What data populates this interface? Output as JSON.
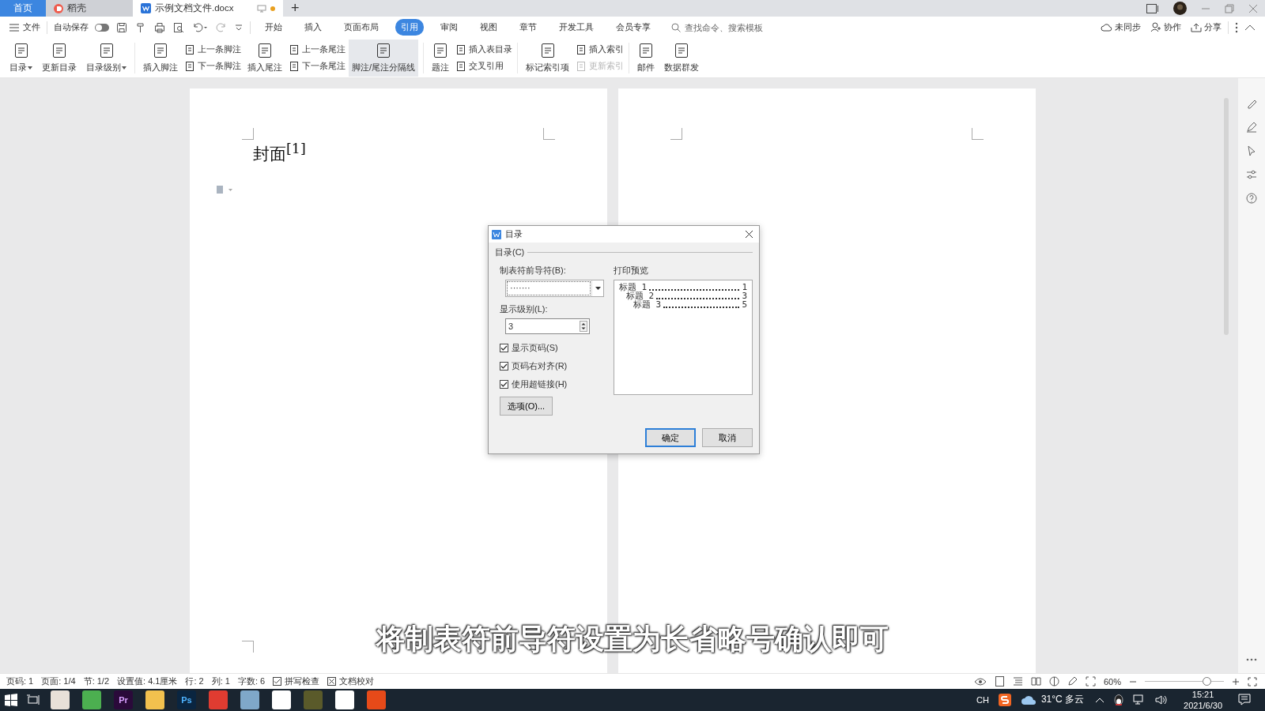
{
  "tabs": [
    {
      "kind": "home",
      "label": "首页",
      "selected": false
    },
    {
      "kind": "app",
      "label": "稻壳",
      "selected": false
    },
    {
      "kind": "doc",
      "label": "示例文档文件.docx",
      "selected": true,
      "unsaved": true
    }
  ],
  "new_tab": "+",
  "menu": {
    "file": "文件",
    "autosave": {
      "label": "自动保存",
      "on": false
    },
    "tabs": [
      {
        "label": "开始",
        "selected": false
      },
      {
        "label": "插入",
        "selected": false
      },
      {
        "label": "页面布局",
        "selected": false
      },
      {
        "label": "引用",
        "selected": true
      },
      {
        "label": "审阅",
        "selected": false
      },
      {
        "label": "视图",
        "selected": false
      },
      {
        "label": "章节",
        "selected": false
      },
      {
        "label": "开发工具",
        "selected": false
      },
      {
        "label": "会员专享",
        "selected": false
      }
    ],
    "search": {
      "placeholder": "查找命令、搜索模板"
    },
    "actions": [
      {
        "kind": "sync",
        "label": "未同步"
      },
      {
        "kind": "collab",
        "label": "协作"
      },
      {
        "kind": "share",
        "label": "分享"
      }
    ]
  },
  "ribbon": [
    {
      "items": [
        {
          "kind": "large",
          "label": "目录",
          "has_menu": true,
          "on": false
        },
        {
          "kind": "large",
          "label": "更新目录",
          "has_menu": false,
          "on": false
        },
        {
          "kind": "large",
          "label": "目录级别",
          "has_menu": true,
          "on": false
        }
      ]
    },
    {
      "items": [
        {
          "kind": "large",
          "label": "插入脚注",
          "has_menu": false,
          "on": false
        },
        {
          "kind": "stack",
          "items": [
            {
              "label": "上一条脚注",
              "disabled": false
            },
            {
              "label": "下一条脚注",
              "disabled": false
            }
          ]
        },
        {
          "kind": "large",
          "label": "插入尾注",
          "has_menu": false,
          "on": false
        },
        {
          "kind": "stack",
          "items": [
            {
              "label": "上一条尾注",
              "disabled": false
            },
            {
              "label": "下一条尾注",
              "disabled": false
            }
          ]
        },
        {
          "kind": "large",
          "label": "脚注/尾注分隔线",
          "has_menu": false,
          "on": true
        }
      ]
    },
    {
      "items": [
        {
          "kind": "large",
          "label": "题注",
          "has_menu": false,
          "on": false
        },
        {
          "kind": "stack",
          "items": [
            {
              "label": "插入表目录",
              "disabled": false
            },
            {
              "label": "交叉引用",
              "disabled": false
            }
          ]
        }
      ]
    },
    {
      "items": [
        {
          "kind": "large",
          "label": "标记索引项",
          "has_menu": false,
          "on": false
        },
        {
          "kind": "stack",
          "items": [
            {
              "label": "插入索引",
              "disabled": false
            },
            {
              "label": "更新索引",
              "disabled": true
            }
          ]
        }
      ]
    },
    {
      "items": [
        {
          "kind": "large",
          "label": "邮件",
          "has_menu": false,
          "on": false
        },
        {
          "kind": "large",
          "label": "数据群发",
          "has_menu": false,
          "on": false
        }
      ]
    }
  ],
  "document": {
    "heading": "封面$^{[1]}$"
  },
  "dialog": {
    "title": "目录",
    "section": "目录(C)",
    "leader_label": "制表符前导符(B):",
    "leader_value": "·······",
    "level_label": "显示级别(L):",
    "level_value": "3",
    "checkboxes": [
      {
        "label": "显示页码(S)",
        "checked": true
      },
      {
        "label": "页码右对齐(R)",
        "checked": true
      },
      {
        "label": "使用超链接(H)",
        "checked": true
      }
    ],
    "options_button": "选项(O)...",
    "preview_label": "打印预览",
    "preview": [
      {
        "text": "标题 1",
        "page": "1",
        "children": [
          {
            "text": "标题 2",
            "page": "3",
            "children": [
              {
                "text": "标题 3",
                "page": "5"
              }
            ]
          }
        ]
      }
    ],
    "ok": "确定",
    "cancel": "取消"
  },
  "subtitle": "将制表符前导符设置为长省略号确认即可",
  "status_bar": {
    "items": [
      "页码: 1",
      "页面: 1/4",
      "节: 1/2",
      "设置值: 4.1厘米",
      "行: 2",
      "列: 1",
      "字数: 6"
    ],
    "checks": [
      "拼写检查",
      "文档校对"
    ],
    "zoom": "60%",
    "zoom_slider": {
      "level": 0.8
    }
  },
  "taskbar": {
    "apps": [
      {
        "kind": "office"
      },
      {
        "kind": "chrome"
      },
      {
        "kind": "premiere",
        "glyph": "Pr"
      },
      {
        "kind": "folder"
      },
      {
        "kind": "photoshop",
        "glyph": "Ps"
      },
      {
        "kind": "wps"
      },
      {
        "kind": "browser"
      },
      {
        "kind": "triangle"
      },
      {
        "kind": "video"
      },
      {
        "kind": "gear"
      },
      {
        "kind": "tool"
      }
    ],
    "ime": "CH",
    "weather": "31°C 多云",
    "time": "15:21",
    "date": "2021/6/30"
  }
}
